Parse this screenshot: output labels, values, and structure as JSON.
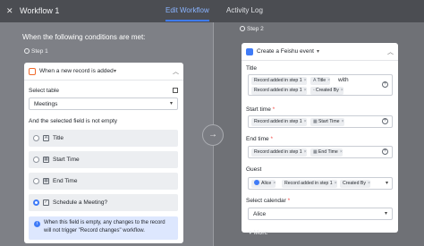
{
  "header": {
    "workflow_title": "Workflow 1",
    "tabs": [
      "Edit Workflow",
      "Activity Log"
    ]
  },
  "left": {
    "conditions_title": "When the following conditions are met:",
    "step_label": "Step 1",
    "trigger": {
      "label": "When a new record is added",
      "select_table_label": "Select table",
      "table_value": "Meetings",
      "field_empty_label": "And the selected field is not empty",
      "fields": [
        {
          "name": "Title",
          "icon": "text-field-icon",
          "selected": false
        },
        {
          "name": "Start Time",
          "icon": "calendar-field-icon",
          "selected": false
        },
        {
          "name": "End Time",
          "icon": "calendar-field-icon",
          "selected": false
        },
        {
          "name": "Schedule a Meeting?",
          "icon": "checkbox-field-icon",
          "selected": true
        }
      ],
      "info_text": "When this field is empty, any changes to the record will not trigger \"Record changes\" workflow."
    }
  },
  "right": {
    "step_label": "Step 2",
    "action": {
      "label": "Create a Feishu event",
      "title_label": "Title",
      "title_tokens": [
        "Record added in step 1",
        "Title",
        "with",
        "Record added in step 1",
        "Created By"
      ],
      "start_label": "Start time",
      "start_tokens": [
        "Record added in step 1",
        "Start Time"
      ],
      "end_label": "End time",
      "end_tokens": [
        "Record added in step 1",
        "End Time"
      ],
      "guest_label": "Guest",
      "guest_tokens": [
        "Alice",
        "Record added in step 1",
        "Created By"
      ],
      "calendar_label": "Select calendar",
      "calendar_value": "Alice",
      "required_mark": "*"
    },
    "more_label": "More"
  },
  "colors": {
    "accent": "#3f7bf7",
    "trigger_icon": "#f06a2c",
    "required": "#f54a45"
  }
}
